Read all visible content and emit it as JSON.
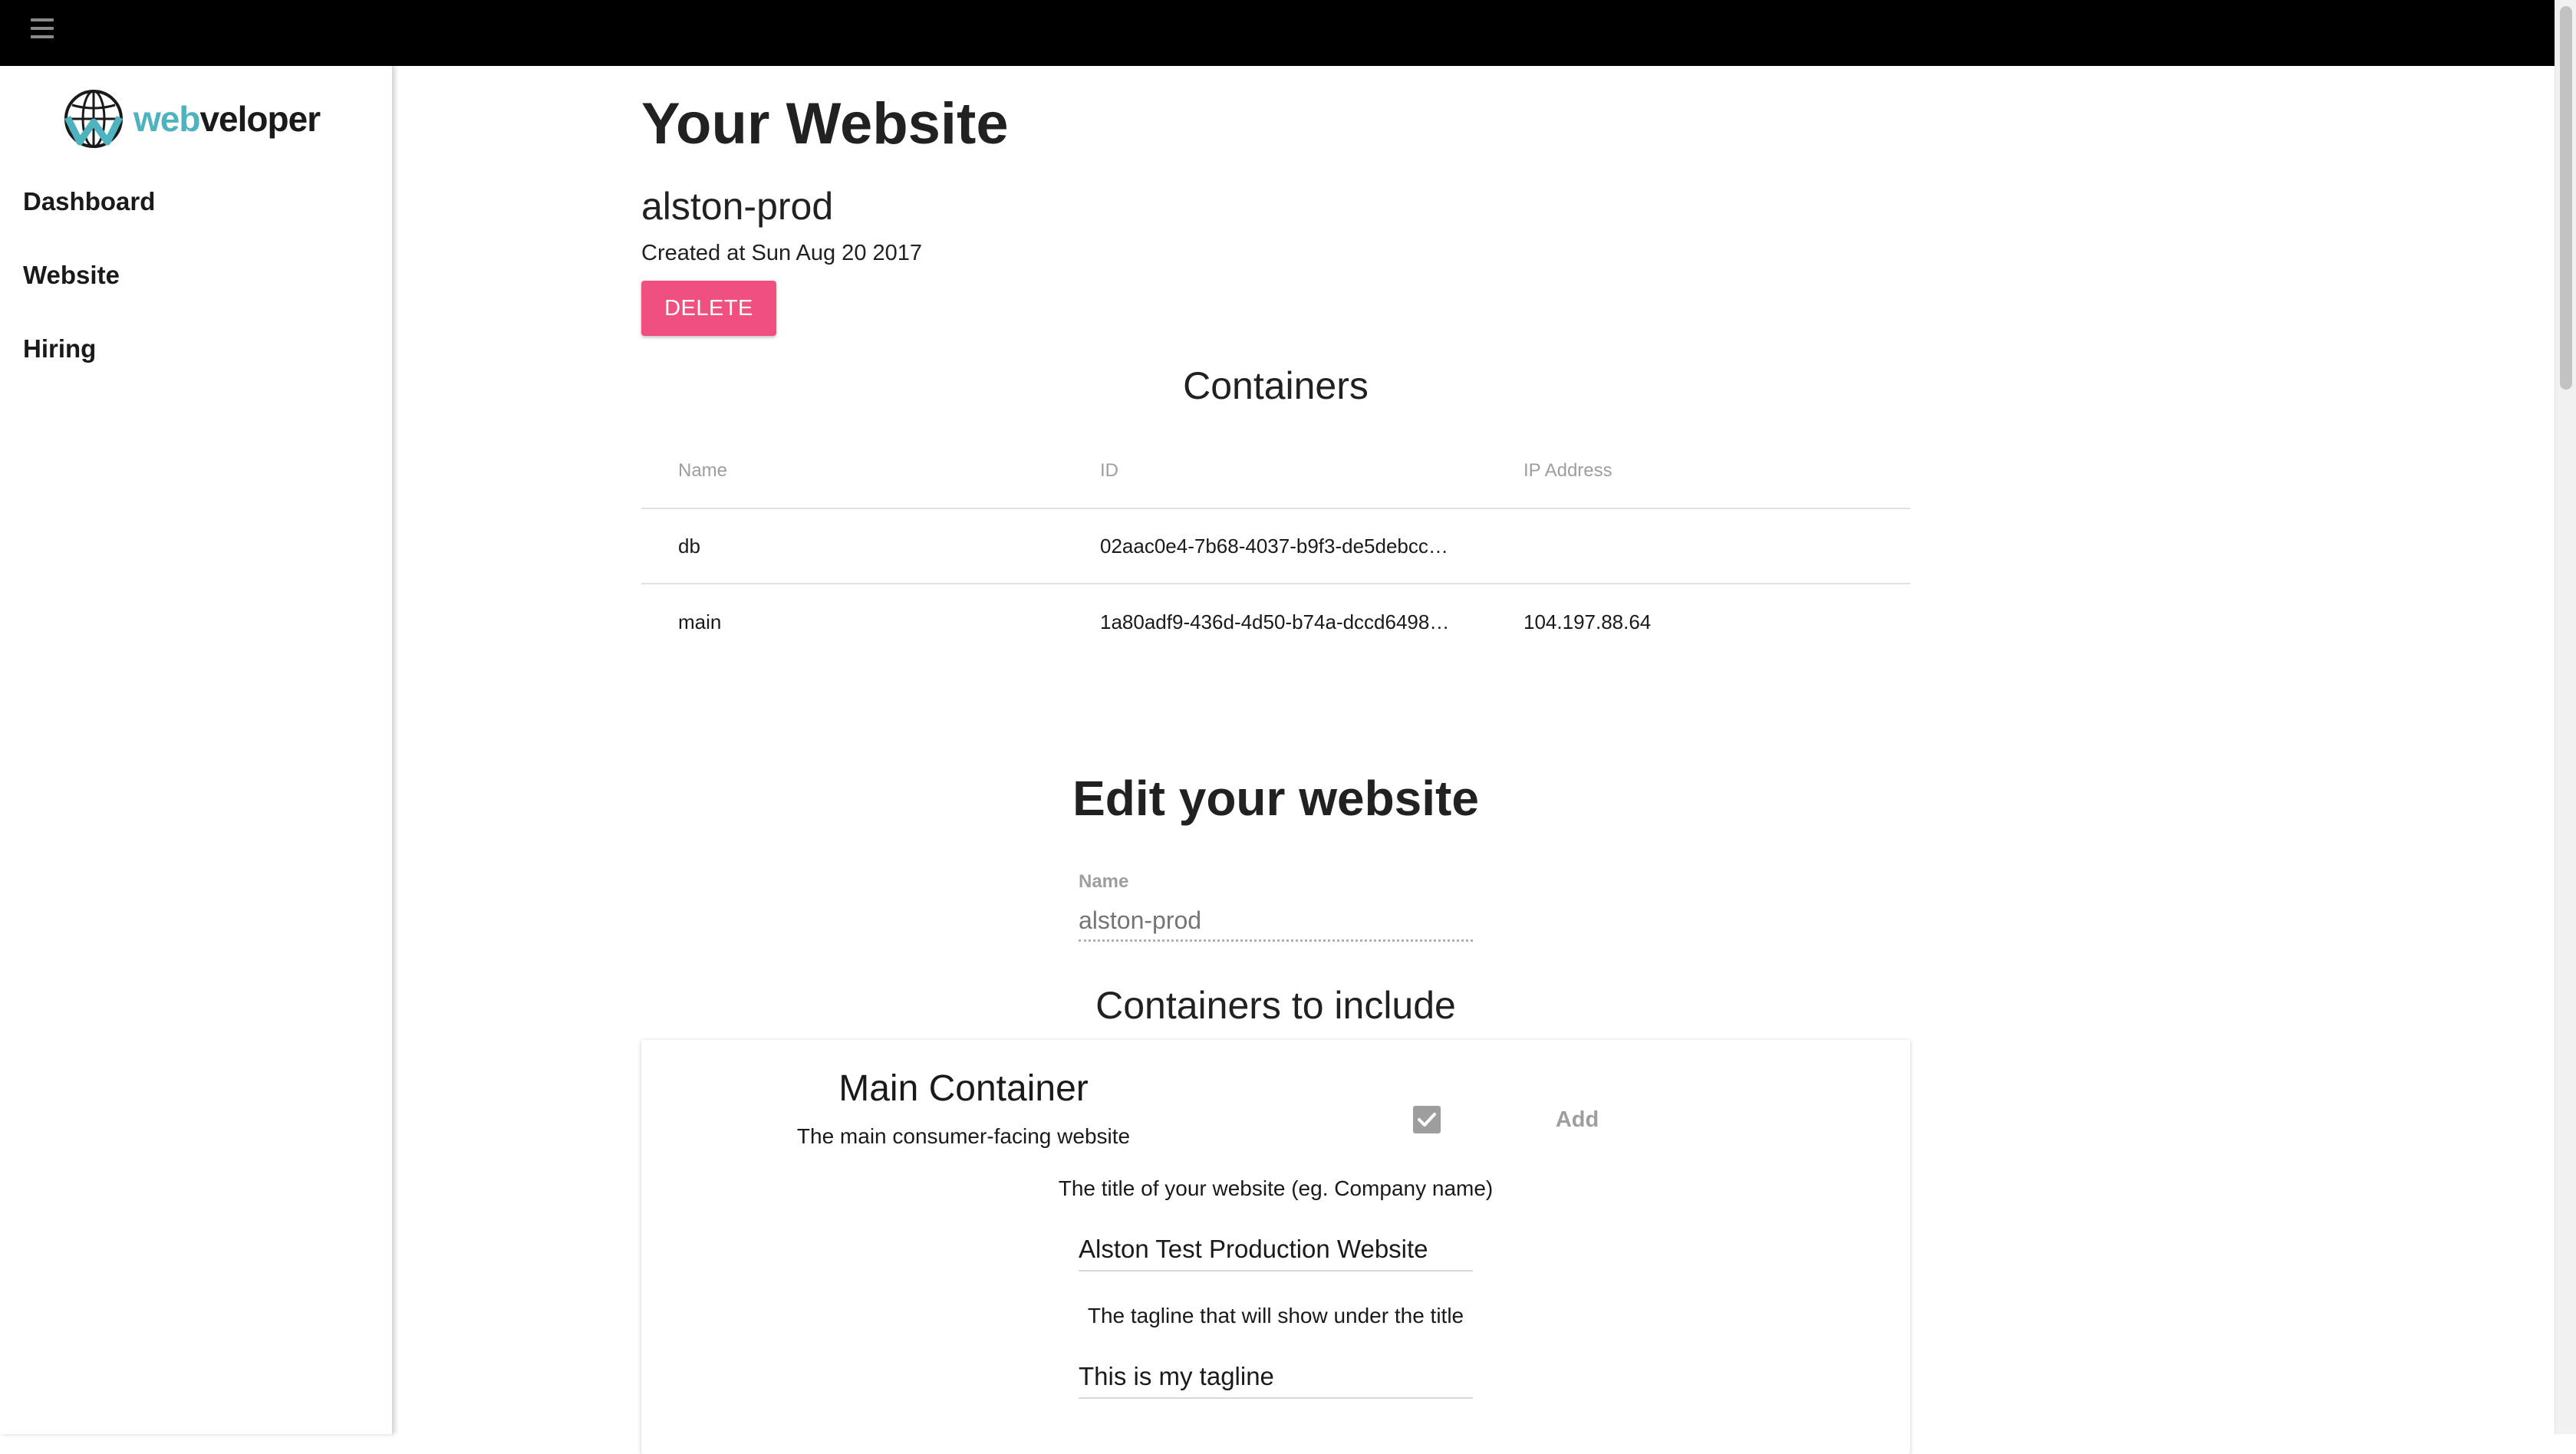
{
  "topbar": {
    "menu_icon": "hamburger-menu-icon"
  },
  "sidebar": {
    "logo": {
      "text_part1": "web",
      "text_part2": "veloper",
      "icon": "globe-logo-icon",
      "colors": {
        "accent": "#4fb3bf",
        "dark": "#1a1a1a"
      }
    },
    "items": [
      {
        "label": "Dashboard"
      },
      {
        "label": "Website"
      },
      {
        "label": "Hiring"
      }
    ]
  },
  "main": {
    "title": "Your Website",
    "site_name": "alston-prod",
    "created": "Created at Sun Aug 20 2017",
    "delete_label": "DELETE",
    "delete_color": "#f0507f",
    "containers_heading": "Containers",
    "table": {
      "headers": [
        "Name",
        "ID",
        "IP Address"
      ],
      "rows": [
        {
          "name": "db",
          "id": "02aac0e4-7b68-4037-b9f3-de5debcc…",
          "ip": ""
        },
        {
          "name": "main",
          "id": "1a80adf9-436d-4d50-b74a-dccd6498…",
          "ip": "104.197.88.64"
        }
      ]
    }
  },
  "edit": {
    "heading": "Edit your website",
    "name_label": "Name",
    "name_placeholder": "alston-prod",
    "containers_heading": "Containers to include",
    "card": {
      "title": "Main Container",
      "description": "The main consumer-facing website",
      "checkbox_checked": true,
      "add_label": "Add",
      "title_hint": "The title of your website (eg. Company name)",
      "title_value": "Alston Test Production Website",
      "tagline_hint": "The tagline that will show under the title",
      "tagline_value": "This is my tagline"
    }
  }
}
